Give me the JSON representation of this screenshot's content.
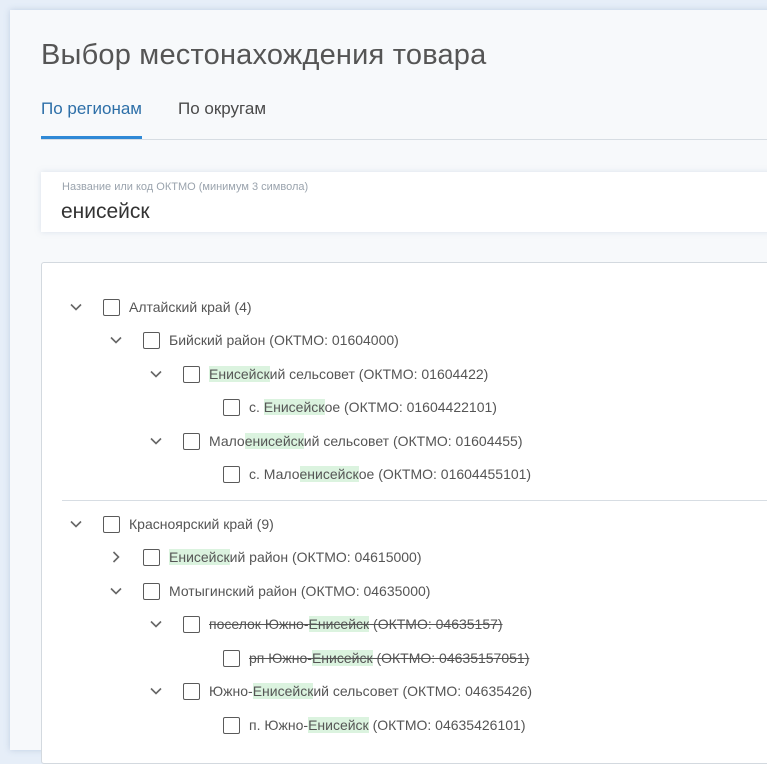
{
  "page": {
    "title": "Выбор местонахождения товара"
  },
  "tabs": [
    {
      "label": "По регионам",
      "active": true
    },
    {
      "label": "По округам",
      "active": false
    }
  ],
  "search": {
    "label": "Название или код ОКТМО (минимум 3 символа)",
    "value": "енисейск"
  },
  "tree": {
    "altai": {
      "label": "Алтайский край (4)",
      "biysk": {
        "label": "Бийский район (ОКТМО: 01604000)",
        "eniseysky_ss": {
          "pre": "",
          "hl": "Енисейск",
          "post": "ий сельсовет (ОКТМО: 01604422)"
        },
        "s_eniseyskoe": {
          "pre": "с. ",
          "hl": "Енисейск",
          "post": "ое (ОКТМО: 01604422101)"
        },
        "maloeniseysky_ss": {
          "pre": "Мало",
          "hl": "енисейск",
          "post": "ий сельсовет (ОКТМО: 01604455)"
        },
        "s_maloeniseyskoe": {
          "pre": "с. Мало",
          "hl": "енисейск",
          "post": "ое (ОКТМО: 01604455101)"
        }
      }
    },
    "krasnoyarsk": {
      "label": "Красноярский край (9)",
      "eniseysky_rayon": {
        "pre": "",
        "hl": "Енисейск",
        "post": "ий район (ОКТМО: 04615000)"
      },
      "motygino": {
        "label": "Мотыгинский район (ОКТМО: 04635000)",
        "poselok_yuzhno": {
          "pre": "поселок Южно-",
          "hl": "Енисейск",
          "post": " (ОКТМО: 04635157)"
        },
        "rp_yuzhno": {
          "pre": "рп Южно-",
          "hl": "Енисейск",
          "post": " (ОКТМО: 04635157051)"
        },
        "yuzhno_ss": {
          "pre": "Южно-",
          "hl": "Енисейск",
          "post": "ий сельсовет (ОКТМО: 04635426)"
        },
        "p_yuzhno": {
          "pre": "п. Южно-",
          "hl": "Енисейск",
          "post": " (ОКТМО: 04635426101)"
        }
      }
    }
  }
}
